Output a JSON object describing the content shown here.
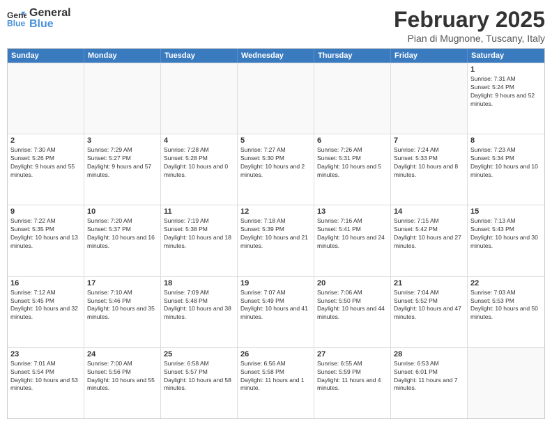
{
  "logo": {
    "line1": "General",
    "line2": "Blue"
  },
  "title": "February 2025",
  "subtitle": "Pian di Mugnone, Tuscany, Italy",
  "header_days": [
    "Sunday",
    "Monday",
    "Tuesday",
    "Wednesday",
    "Thursday",
    "Friday",
    "Saturday"
  ],
  "weeks": [
    [
      {
        "day": "",
        "info": ""
      },
      {
        "day": "",
        "info": ""
      },
      {
        "day": "",
        "info": ""
      },
      {
        "day": "",
        "info": ""
      },
      {
        "day": "",
        "info": ""
      },
      {
        "day": "",
        "info": ""
      },
      {
        "day": "1",
        "info": "Sunrise: 7:31 AM\nSunset: 5:24 PM\nDaylight: 9 hours and 52 minutes."
      }
    ],
    [
      {
        "day": "2",
        "info": "Sunrise: 7:30 AM\nSunset: 5:26 PM\nDaylight: 9 hours and 55 minutes."
      },
      {
        "day": "3",
        "info": "Sunrise: 7:29 AM\nSunset: 5:27 PM\nDaylight: 9 hours and 57 minutes."
      },
      {
        "day": "4",
        "info": "Sunrise: 7:28 AM\nSunset: 5:28 PM\nDaylight: 10 hours and 0 minutes."
      },
      {
        "day": "5",
        "info": "Sunrise: 7:27 AM\nSunset: 5:30 PM\nDaylight: 10 hours and 2 minutes."
      },
      {
        "day": "6",
        "info": "Sunrise: 7:26 AM\nSunset: 5:31 PM\nDaylight: 10 hours and 5 minutes."
      },
      {
        "day": "7",
        "info": "Sunrise: 7:24 AM\nSunset: 5:33 PM\nDaylight: 10 hours and 8 minutes."
      },
      {
        "day": "8",
        "info": "Sunrise: 7:23 AM\nSunset: 5:34 PM\nDaylight: 10 hours and 10 minutes."
      }
    ],
    [
      {
        "day": "9",
        "info": "Sunrise: 7:22 AM\nSunset: 5:35 PM\nDaylight: 10 hours and 13 minutes."
      },
      {
        "day": "10",
        "info": "Sunrise: 7:20 AM\nSunset: 5:37 PM\nDaylight: 10 hours and 16 minutes."
      },
      {
        "day": "11",
        "info": "Sunrise: 7:19 AM\nSunset: 5:38 PM\nDaylight: 10 hours and 18 minutes."
      },
      {
        "day": "12",
        "info": "Sunrise: 7:18 AM\nSunset: 5:39 PM\nDaylight: 10 hours and 21 minutes."
      },
      {
        "day": "13",
        "info": "Sunrise: 7:16 AM\nSunset: 5:41 PM\nDaylight: 10 hours and 24 minutes."
      },
      {
        "day": "14",
        "info": "Sunrise: 7:15 AM\nSunset: 5:42 PM\nDaylight: 10 hours and 27 minutes."
      },
      {
        "day": "15",
        "info": "Sunrise: 7:13 AM\nSunset: 5:43 PM\nDaylight: 10 hours and 30 minutes."
      }
    ],
    [
      {
        "day": "16",
        "info": "Sunrise: 7:12 AM\nSunset: 5:45 PM\nDaylight: 10 hours and 32 minutes."
      },
      {
        "day": "17",
        "info": "Sunrise: 7:10 AM\nSunset: 5:46 PM\nDaylight: 10 hours and 35 minutes."
      },
      {
        "day": "18",
        "info": "Sunrise: 7:09 AM\nSunset: 5:48 PM\nDaylight: 10 hours and 38 minutes."
      },
      {
        "day": "19",
        "info": "Sunrise: 7:07 AM\nSunset: 5:49 PM\nDaylight: 10 hours and 41 minutes."
      },
      {
        "day": "20",
        "info": "Sunrise: 7:06 AM\nSunset: 5:50 PM\nDaylight: 10 hours and 44 minutes."
      },
      {
        "day": "21",
        "info": "Sunrise: 7:04 AM\nSunset: 5:52 PM\nDaylight: 10 hours and 47 minutes."
      },
      {
        "day": "22",
        "info": "Sunrise: 7:03 AM\nSunset: 5:53 PM\nDaylight: 10 hours and 50 minutes."
      }
    ],
    [
      {
        "day": "23",
        "info": "Sunrise: 7:01 AM\nSunset: 5:54 PM\nDaylight: 10 hours and 53 minutes."
      },
      {
        "day": "24",
        "info": "Sunrise: 7:00 AM\nSunset: 5:56 PM\nDaylight: 10 hours and 55 minutes."
      },
      {
        "day": "25",
        "info": "Sunrise: 6:58 AM\nSunset: 5:57 PM\nDaylight: 10 hours and 58 minutes."
      },
      {
        "day": "26",
        "info": "Sunrise: 6:56 AM\nSunset: 5:58 PM\nDaylight: 11 hours and 1 minute."
      },
      {
        "day": "27",
        "info": "Sunrise: 6:55 AM\nSunset: 5:59 PM\nDaylight: 11 hours and 4 minutes."
      },
      {
        "day": "28",
        "info": "Sunrise: 6:53 AM\nSunset: 6:01 PM\nDaylight: 11 hours and 7 minutes."
      },
      {
        "day": "",
        "info": ""
      }
    ]
  ]
}
